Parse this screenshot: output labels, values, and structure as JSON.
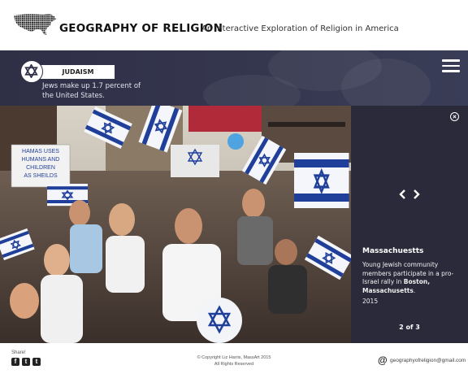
{
  "header": {
    "brand": "GEOGRAPHY OF RELIGION",
    "tagline": "An Interactive Exploration of Religion in America"
  },
  "religion": {
    "name": "JUDAISM",
    "fact": "Jews make up 1.7 percent of the United States."
  },
  "slide": {
    "location": "Massachuestts",
    "description_before": "Young Jewish community members participate in a pro-Israel rally in ",
    "description_bold": "Boston, Massachusetts",
    "description_after": ".",
    "year": "2015",
    "pager": "2 of 3"
  },
  "photo": {
    "sign_text": "HAMAS USES HUMANS AND CHILDREN AS SHEILDS"
  },
  "footer": {
    "share_label": "Share!",
    "social": [
      "f",
      "t",
      "t"
    ],
    "copyright_line1": "© Copyright Liz Harris, MassArt 2015",
    "copyright_line2": "All Rights Reserved",
    "email_icon": "@",
    "email": "geographyofreligion@gmail.com"
  },
  "colors": {
    "band": "#2f2f46",
    "panel": "#2a2a3b",
    "flag_blue": "#1f3f9a"
  }
}
